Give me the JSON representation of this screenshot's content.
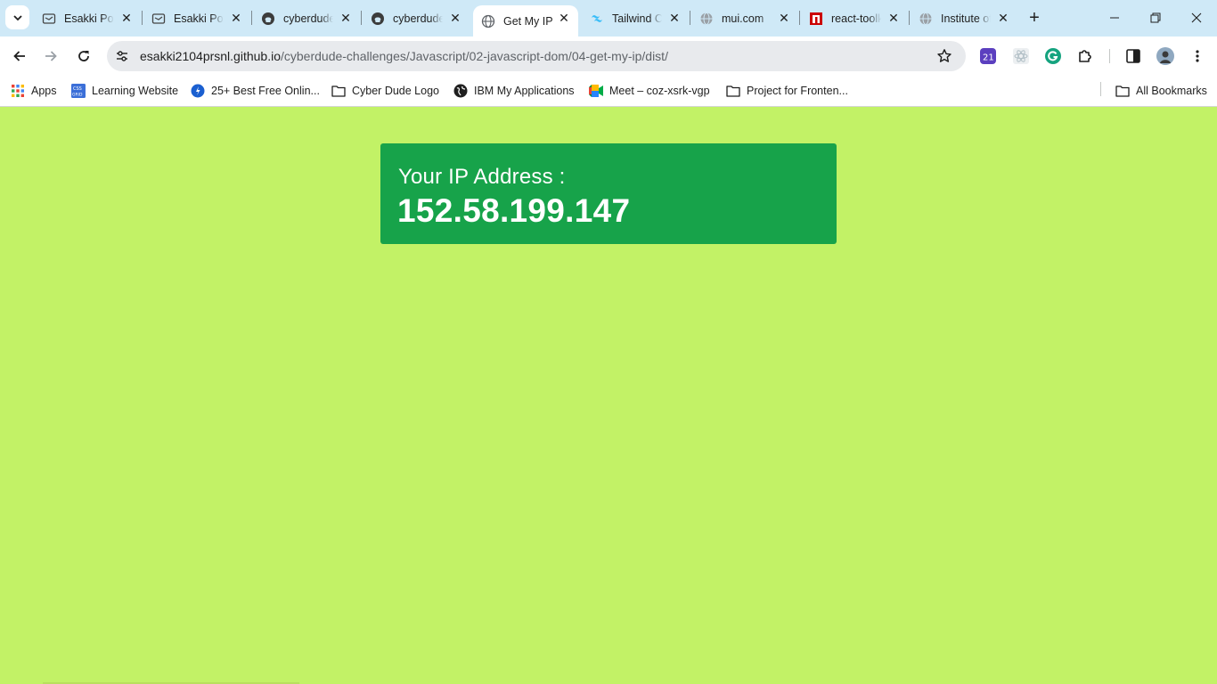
{
  "tabs": [
    {
      "title": "Esakki Portfolio",
      "favicon": "portfolio-icon",
      "active": false
    },
    {
      "title": "Esakki Portfolio",
      "favicon": "portfolio-icon",
      "active": false
    },
    {
      "title": "cyberdude-challenges",
      "favicon": "github-icon",
      "active": false
    },
    {
      "title": "cyberdude-challenges",
      "favicon": "github-icon",
      "active": false
    },
    {
      "title": "Get My IP",
      "favicon": "globe-icon",
      "active": true
    },
    {
      "title": "Tailwind CSS",
      "favicon": "tailwind-icon",
      "active": false
    },
    {
      "title": "mui.com",
      "favicon": "globe-icon",
      "active": false
    },
    {
      "title": "react-toolkit",
      "favicon": "npm-icon",
      "active": false
    },
    {
      "title": "Institute of",
      "favicon": "globe-icon",
      "active": false
    }
  ],
  "address_bar": {
    "domain": "esakki2104prsnl.github.io",
    "path": "/cyberdude-challenges/Javascript/02-javascript-dom/04-get-my-ip/dist/"
  },
  "bookmarks": [
    {
      "label": "Apps",
      "icon": "apps-grid-icon"
    },
    {
      "label": "Learning Website",
      "icon": "css-grid-icon"
    },
    {
      "label": "25+ Best Free Onlin...",
      "icon": "site-icon"
    },
    {
      "label": "Cyber Dude Logo",
      "icon": "folder-icon"
    },
    {
      "label": "IBM My Applications",
      "icon": "globe-icon"
    },
    {
      "label": "Meet – coz-xsrk-vgp",
      "icon": "meet-icon"
    },
    {
      "label": "Project for Fronten...",
      "icon": "folder-icon"
    }
  ],
  "all_bookmarks": "All Bookmarks",
  "page": {
    "label": "Your IP Address :",
    "ip": "152.58.199.147"
  },
  "colors": {
    "page_background": "#c2f266",
    "card_background": "#17a34a",
    "card_text": "#ffffff"
  }
}
